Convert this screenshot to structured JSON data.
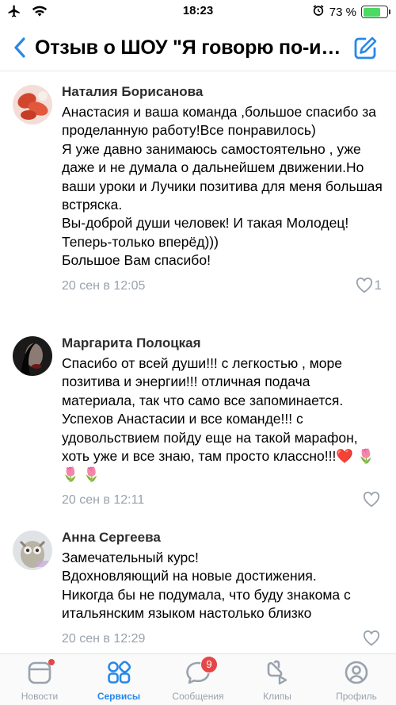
{
  "status_bar": {
    "time": "18:23",
    "battery_percent": "73 %",
    "battery_level": 0.73,
    "icons": [
      "airplane-icon",
      "wifi-icon",
      "alarm-icon",
      "battery-icon"
    ]
  },
  "header": {
    "title": "Отзыв о ШОУ \"Я говорю по-итальянски\""
  },
  "comments": [
    {
      "author": "Наталия Борисанова",
      "text": "Анастасия и ваша команда ,большое спасибо за проделанную работу!Все понравилось)\nЯ уже давно занимаюсь самостоятельно , уже даже и не думала о дальнейшем движении.Но ваши  уроки и   Лучики позитива для меня большая встряска.\nВы-доброй души человек! И такая Молодец! Теперь-только вперёд)))\nБольшое Вам спасибо!",
      "date": "20 сен в 12:05",
      "likes": "1"
    },
    {
      "author": "Маргарита Полоцкая",
      "text": "Спасибо от всей души!!! с легкостью , море позитива и энергии!!! отличная подача материала, так что само все запоминается. Успехов Анастасии и все команде!!! с удовольствием пойду еще на такой марафон, хоть уже и все знаю, там просто классно!!!❤️ 🌷 🌷 🌷",
      "date": "20 сен в 12:11",
      "likes": ""
    },
    {
      "author": "Анна Сергеева",
      "text": "Замечательный курс!\nВдохновляющий на новые достижения.\nНикогда бы не подумала,  что буду знакома с итальянским языком настолько близко",
      "date": "20 сен в 12:29",
      "likes": ""
    }
  ],
  "tabs": [
    {
      "label": "Новости",
      "icon": "news-icon",
      "active": false
    },
    {
      "label": "Сервисы",
      "icon": "services-icon",
      "active": true
    },
    {
      "label": "Сообщения",
      "icon": "messages-icon",
      "active": false,
      "badge": "9"
    },
    {
      "label": "Клипы",
      "icon": "clips-icon",
      "active": false
    },
    {
      "label": "Профиль",
      "icon": "profile-icon",
      "active": false
    }
  ],
  "colors": {
    "accent": "#2688eb",
    "secondary_text": "#99a2ad",
    "badge": "#e64646"
  }
}
